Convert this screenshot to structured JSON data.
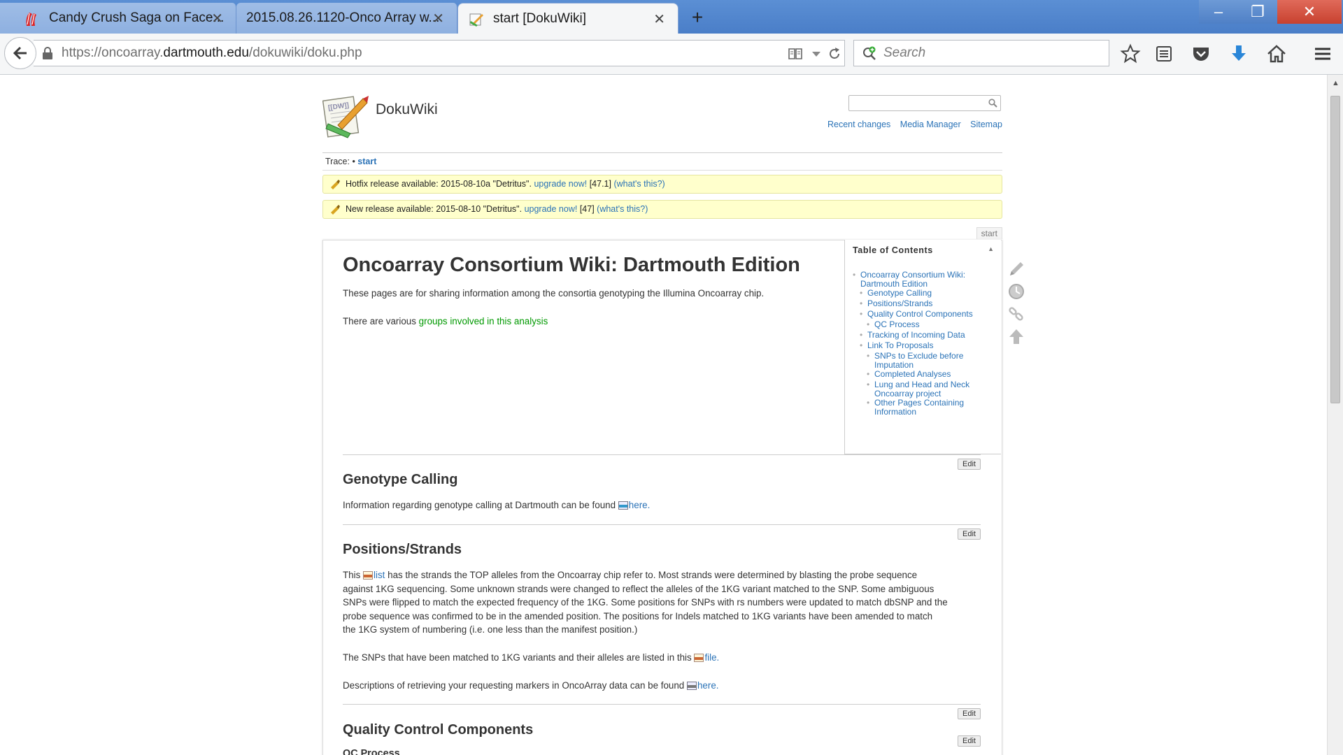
{
  "browser": {
    "tabs": [
      {
        "title": "Candy Crush Saga on Face...",
        "active": false
      },
      {
        "title": "2015.08.26.1120-Onco Array w...",
        "active": false
      },
      {
        "title": "start [DokuWiki]",
        "active": true
      }
    ],
    "new_tab": "+",
    "window_controls": {
      "minimize": "–",
      "maximize": "❐",
      "close": "✕"
    },
    "url_prefix": "https://oncoarray.",
    "url_domain": "dartmouth.edu",
    "url_suffix": "/dokuwiki/doku.php",
    "search_placeholder": "Search",
    "icons": [
      "back-arrow-icon",
      "lock-icon",
      "reader-view-icon",
      "dropdown-arrow-icon",
      "reload-icon",
      "search-engine-icon",
      "bookmark-star-icon",
      "bookmarks-list-icon",
      "pocket-icon",
      "downloads-icon",
      "home-icon",
      "menu-icon"
    ]
  },
  "wiki": {
    "site_title": "DokuWiki",
    "tools": [
      "Recent changes",
      "Media Manager",
      "Sitemap"
    ],
    "trace_label": "Trace:",
    "trace_sep": " • ",
    "trace_link": "start",
    "notices": [
      {
        "text": "Hotfix release available: 2015-08-10a \"Detritus\".",
        "link": "upgrade now!",
        "version": "[47.1]",
        "whats": "(what's this?)"
      },
      {
        "text": "New release available: 2015-08-10 \"Detritus\".",
        "link": "upgrade now!",
        "version": "[47]",
        "whats": "(what's this?)"
      }
    ],
    "page_id": "start",
    "toc": {
      "title": "Table of Contents",
      "collapse": "▲",
      "items": [
        {
          "label": "Oncoarray Consortium Wiki: Dartmouth Edition",
          "level": 1
        },
        {
          "label": "Genotype Calling",
          "level": 2
        },
        {
          "label": "Positions/Strands",
          "level": 2
        },
        {
          "label": "Quality Control Components",
          "level": 2
        },
        {
          "label": "QC Process",
          "level": 3
        },
        {
          "label": "Tracking of Incoming Data",
          "level": 2
        },
        {
          "label": "Link To Proposals",
          "level": 2
        },
        {
          "label": "SNPs to Exclude before Imputation",
          "level": 3
        },
        {
          "label": "Completed Analyses",
          "level": 3
        },
        {
          "label": "Lung and Head and Neck Oncoarray project",
          "level": 3
        },
        {
          "label": "Other Pages Containing Information",
          "level": 3
        }
      ]
    },
    "content": {
      "h1": "Oncoarray Consortium Wiki: Dartmouth Edition",
      "intro": "These pages are for sharing information among the consortia genotyping the Illumina Oncoarray chip.",
      "groups_prefix": "There are various ",
      "groups_link": "groups involved in this analysis",
      "edit_label": "Edit",
      "genotype": {
        "heading": "Genotype Calling",
        "text": "Information regarding genotype calling at Dartmouth can be found ",
        "link": "here."
      },
      "positions": {
        "heading": "Positions/Strands",
        "p1_prefix": "This ",
        "p1_link": "list",
        "p1_line1": " has the strands the TOP alleles from the Oncoarray chip refer to. Most strands were determined by blasting the probe sequence",
        "p1_line2": "against 1KG sequencing. Some unknown strands were changed to reflect the alleles of the 1KG variant matched to the SNP. Some ambiguous",
        "p1_line3": "SNPs were flipped to match the expected frequency of the 1KG. Some positions for SNPs with rs numbers were updated to match dbSNP and the",
        "p1_line4": "probe sequence was confirmed to be in the amended position. The positions for Indels matched to 1KG variants have been amended to match",
        "p1_line5": "the 1KG system of numbering (i.e. one less than the manifest position.)",
        "p2_text": "The SNPs that have been matched to 1KG variants and their alleles are listed in this ",
        "p2_link": "file.",
        "p3_text": "Descriptions of retrieving your requesting markers in OncoArray data can be found ",
        "p3_link": "here."
      },
      "qc": {
        "heading": "Quality Control Components",
        "sub": "QC Process"
      }
    },
    "page_tools": [
      "edit-pencil-icon",
      "revisions-clock-icon",
      "backlinks-chain-icon",
      "back-to-top-arrow-icon"
    ]
  }
}
